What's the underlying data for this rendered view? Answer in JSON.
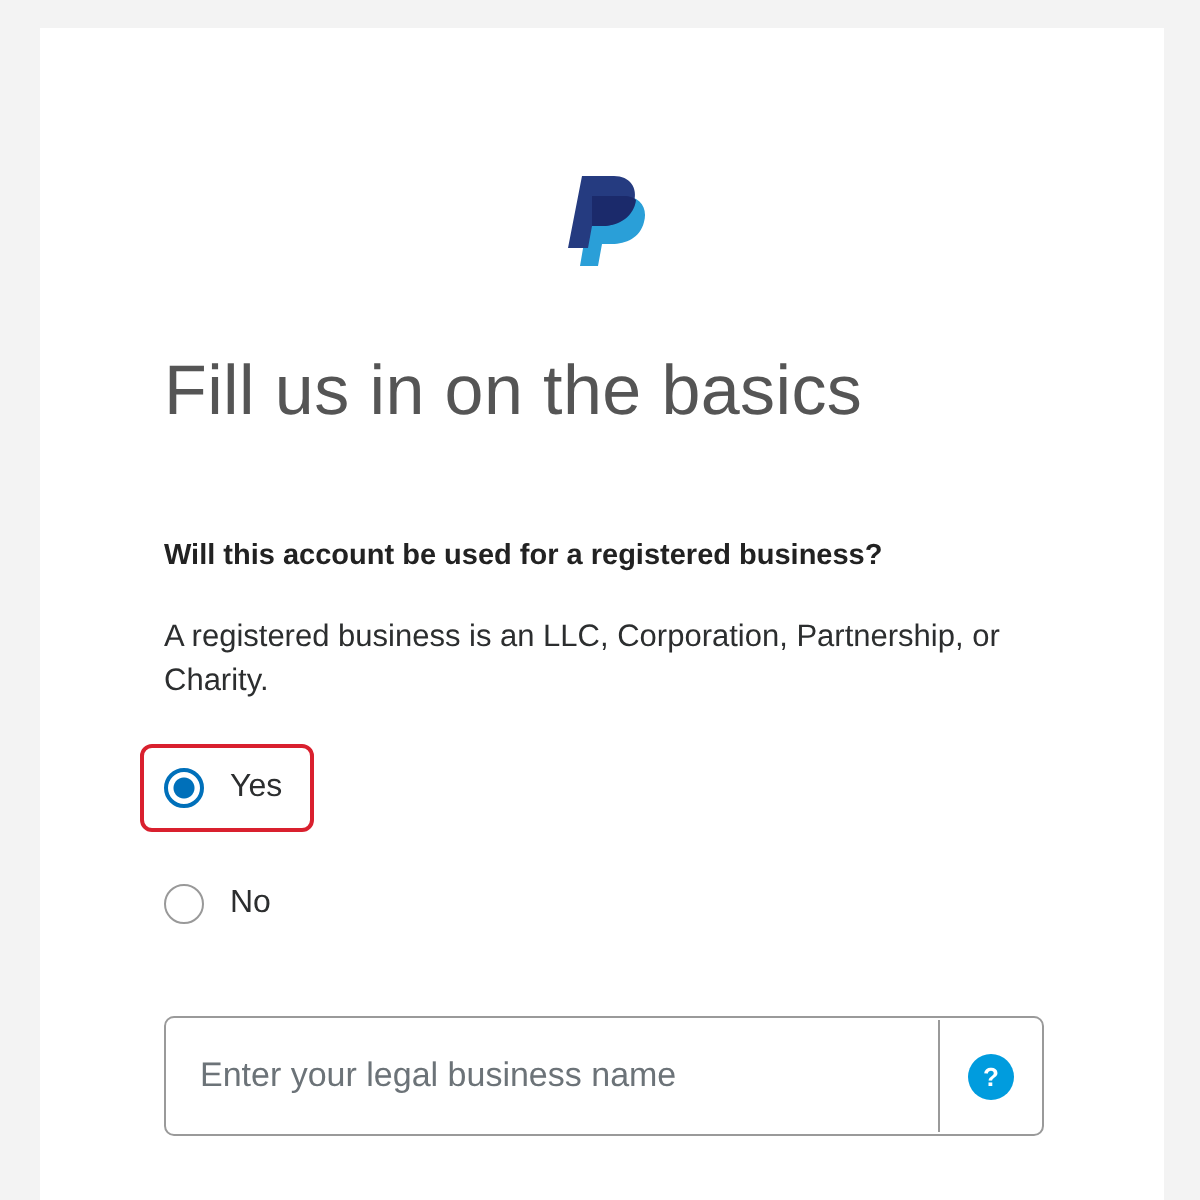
{
  "heading": "Fill us in on the basics",
  "question": "Will this account be used for a registered business?",
  "description": "A registered business is an LLC, Corporation, Partnership, or Charity.",
  "options": [
    {
      "label": "Yes",
      "selected": true,
      "highlighted": true
    },
    {
      "label": "No",
      "selected": false,
      "highlighted": false
    }
  ],
  "business_name_field": {
    "placeholder": "Enter your legal business name",
    "help": "?"
  }
}
